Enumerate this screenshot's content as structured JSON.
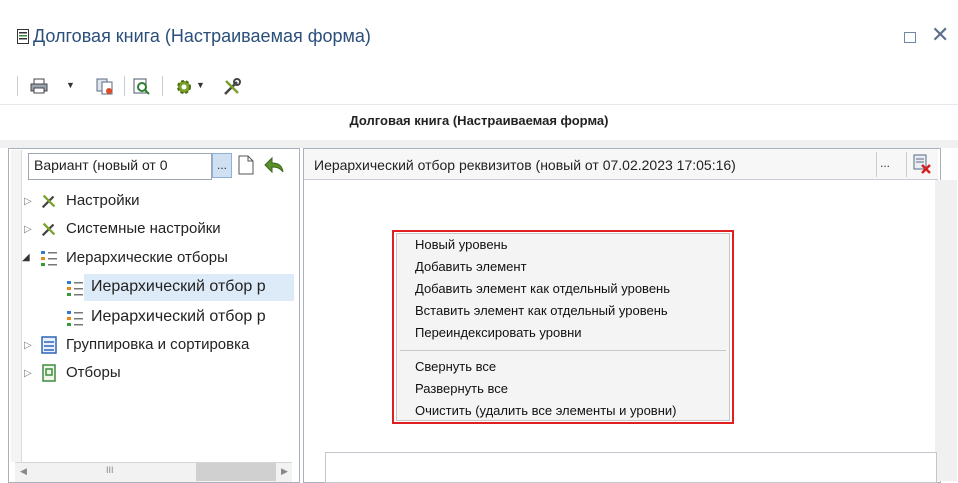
{
  "window": {
    "title": "Долговая книга (Настраиваемая форма)",
    "header_band": "Долговая книга (Настраиваемая форма)"
  },
  "toolbar": {
    "icons": [
      "print-icon",
      "dropdown-arrow-icon",
      "copy-icon",
      "preview-icon",
      "gear-icon",
      "tools-icon"
    ]
  },
  "left_panel": {
    "variant_combo": "Вариант (новый от 0",
    "dots_label": "...",
    "tree": [
      {
        "label": "Настройки",
        "icon": "tools-icon",
        "expanded": false
      },
      {
        "label": "Системные настройки",
        "icon": "tools-icon",
        "expanded": false
      },
      {
        "label": "Иерархические отборы",
        "icon": "hierarchy-icon",
        "expanded": true
      },
      {
        "label": "Иерархический отбор р",
        "icon": "hierarchy-icon",
        "selected": true
      },
      {
        "label": "Иерархический отбор р",
        "icon": "hierarchy-icon"
      },
      {
        "label": "Группировка и сортировка",
        "icon": "grouping-icon",
        "expanded": false
      },
      {
        "label": "Отборы",
        "icon": "filter-icon",
        "expanded": false
      }
    ],
    "scroll_grip": "III"
  },
  "right_panel": {
    "header": "Иерархический отбор реквизитов (новый от 07.02.2023 17:05:16)",
    "dots_label": "..."
  },
  "context_menu": {
    "group1": [
      "Новый уровень",
      "Добавить элемент",
      "Добавить элемент как отдельный уровень",
      "Вставить элемент как отдельный уровень",
      "Переиндексировать уровни"
    ],
    "group2": [
      "Свернуть все",
      "Развернуть все",
      "Очистить (удалить все элементы и уровни)"
    ]
  },
  "colors": {
    "title_text": "#2b4f7a",
    "menu_highlight_border": "#e02020",
    "selection": "#ddeaf8"
  }
}
